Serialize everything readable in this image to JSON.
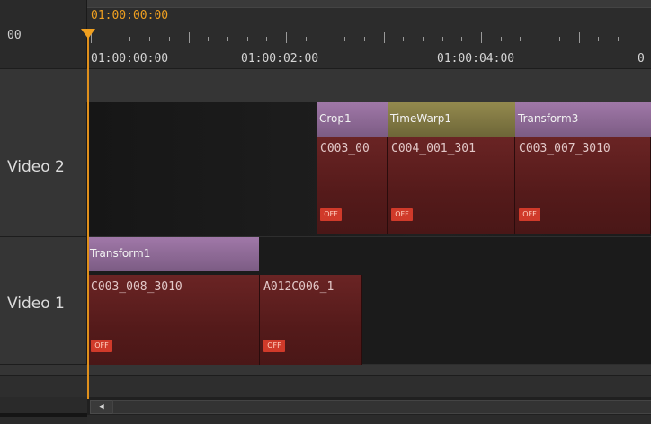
{
  "header": {
    "left_timecode": "00",
    "current_time": "01:00:00:00",
    "ruler_labels": [
      "01:00:00:00",
      "01:00:02:00",
      "01:00:04:00",
      "0"
    ]
  },
  "tracks": {
    "video2": {
      "label": "Video 2",
      "effects": [
        "Crop1",
        "TimeWarp1",
        "Transform3"
      ],
      "clips": [
        {
          "name": "C003_00",
          "status": "OFF"
        },
        {
          "name": "C004_001_301",
          "status": "OFF"
        },
        {
          "name": "C003_007_3010",
          "status": "OFF"
        }
      ]
    },
    "video1": {
      "label": "Video 1",
      "effects": [
        "Transform1"
      ],
      "clips": [
        {
          "name": "C003_008_3010",
          "status": "OFF"
        },
        {
          "name": "A012C006_1",
          "status": "OFF"
        }
      ]
    }
  },
  "scrollbar": {
    "left_arrow": "◀"
  },
  "colors": {
    "playhead": "#f0a020",
    "clip": "#6a2424",
    "effect_purple": "#a078a8",
    "effect_olive": "#948a4e",
    "off_badge": "#d03a2a"
  }
}
